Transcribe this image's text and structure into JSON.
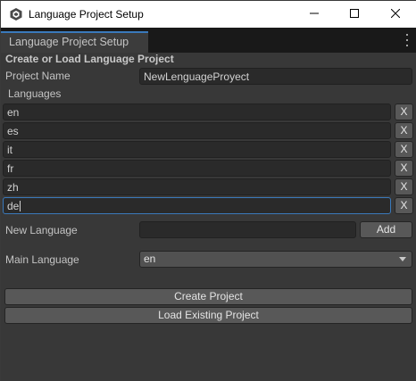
{
  "window": {
    "title": "Language Project Setup",
    "app_icon": "unity-cube-icon",
    "controls": [
      "minimize-icon",
      "maximize-icon",
      "close-icon"
    ]
  },
  "tab": {
    "label": "Language Project Setup",
    "menu_icon": "kebab-menu-icon"
  },
  "form": {
    "section_title": "Create or Load Language Project",
    "project_name_label": "Project Name",
    "project_name_value": "NewLenguageProyect",
    "languages_label": "Languages",
    "languages": [
      {
        "code": "en",
        "remove_label": "X"
      },
      {
        "code": "es",
        "remove_label": "X"
      },
      {
        "code": "it",
        "remove_label": "X"
      },
      {
        "code": "fr",
        "remove_label": "X"
      },
      {
        "code": "zh",
        "remove_label": "X"
      },
      {
        "code": "de",
        "remove_label": "X"
      }
    ],
    "new_language_label": "New Language",
    "new_language_value": "",
    "add_label": "Add",
    "main_language_label": "Main Language",
    "main_language_value": "en",
    "create_project_label": "Create Project",
    "load_project_label": "Load Existing Project"
  },
  "colors": {
    "background": "#383838",
    "field": "#2a2a2a",
    "button": "#585858",
    "focus_accent": "#3a79bb"
  }
}
